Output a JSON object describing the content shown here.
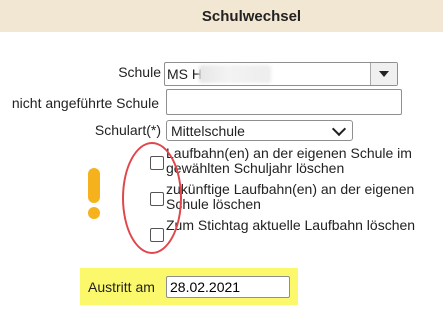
{
  "header": {
    "title": "Schulwechsel"
  },
  "form": {
    "school_label": "Schule",
    "school_value": "MS H",
    "other_school_label": "nicht angeführte Schule",
    "other_school_value": "",
    "school_type_label": "Schulart(*)",
    "school_type_value": "Mittelschule",
    "checkboxes": [
      {
        "label": "Laufbahn(en) an der eigenen Schule im gewählten Schuljahr löschen",
        "checked": false
      },
      {
        "label": "zukünftige Laufbahn(en) an der eigenen Schule löschen",
        "checked": false
      },
      {
        "label": "Zum Stichtag aktuelle Laufbahn löschen",
        "checked": false
      }
    ],
    "exit_label": "Austritt am",
    "exit_value": "28.02.2021"
  },
  "colors": {
    "header_bg": "#f2e7d2",
    "highlight": "#fbf96b",
    "annotation_red": "#e0474c",
    "exclamation": "#f5b21c"
  }
}
